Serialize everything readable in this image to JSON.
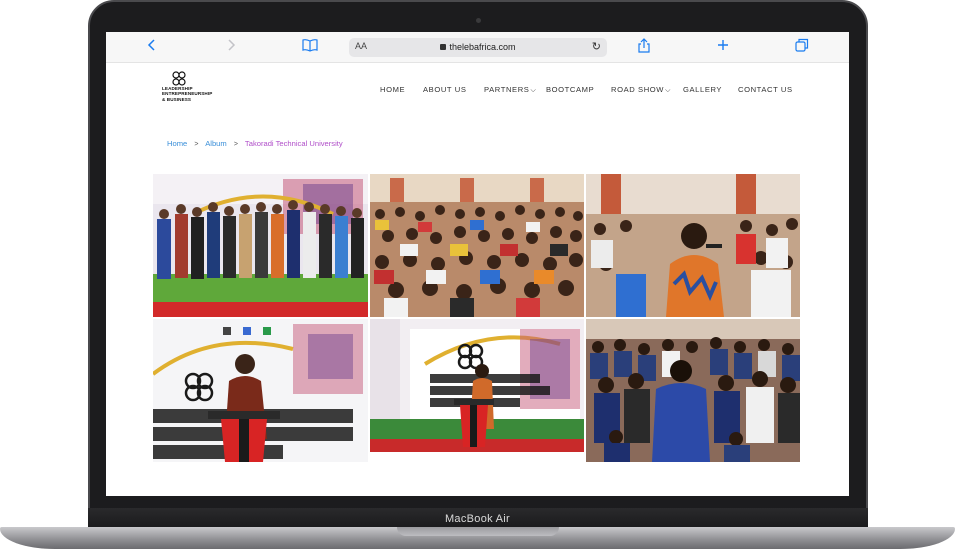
{
  "device": {
    "model_label": "MacBook Air"
  },
  "browser": {
    "reader_label": "AA",
    "url": "thelebafrica.com",
    "icons": [
      "back-icon",
      "forward-icon",
      "bookmarks-icon",
      "lock-icon",
      "reload-icon",
      "share-icon",
      "new-tab-icon",
      "tabs-icon"
    ]
  },
  "site": {
    "logo_lines": [
      "LEADERSHIP",
      "ENTREPRENEURSHIP",
      "& BUSINESS"
    ],
    "nav": [
      {
        "label": "HOME",
        "has_dropdown": false
      },
      {
        "label": "ABOUT US",
        "has_dropdown": false
      },
      {
        "label": "PARTNERS",
        "has_dropdown": true
      },
      {
        "label": "BOOTCAMP",
        "has_dropdown": false
      },
      {
        "label": "ROAD SHOW",
        "has_dropdown": true
      },
      {
        "label": "GALLERY",
        "has_dropdown": false
      },
      {
        "label": "CONTACT US",
        "has_dropdown": false
      }
    ],
    "breadcrumb": {
      "items": [
        "Home",
        "Album"
      ],
      "current": "Takoradi Technical University",
      "separator": ">"
    },
    "gallery": {
      "photos": [
        "group-photo",
        "audience-hall",
        "woman-speaking",
        "man-at-podium",
        "woman-at-podium",
        "students-standing"
      ]
    }
  },
  "colors": {
    "link": "#3a8fd9",
    "current_crumb": "#b04fc9",
    "browser_accent": "#1a7cf0",
    "laptop_frame": "#1c1c1e"
  }
}
